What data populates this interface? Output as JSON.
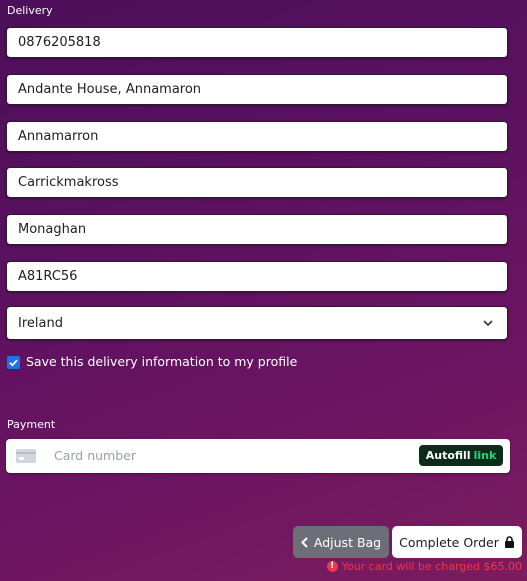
{
  "delivery": {
    "heading": "Delivery",
    "phone": "0876205818",
    "address_line1": "Andante House, Annamaron",
    "address_line2": "Annamarron",
    "town": "Carrickmakross",
    "county": "Monaghan",
    "postcode": "A81RC56",
    "country": "Ireland",
    "save_label": "Save this delivery information to my profile",
    "save_checked": true
  },
  "payment": {
    "heading": "Payment",
    "card_placeholder": "Card number",
    "autofill_label": "Autofill",
    "autofill_link": "link",
    "card_icon": "credit-card-icon"
  },
  "actions": {
    "adjust_label": "Adjust Bag",
    "adjust_icon": "chevron-left-icon",
    "complete_label": "Complete Order",
    "complete_icon": "lock-icon"
  },
  "notice": {
    "charge_text": "Your card will be charged $65.00",
    "icon": "alert-icon"
  },
  "colors": {
    "background": "#5a1160",
    "checkbox": "#1a73e8",
    "adjust_button": "#6e6e78",
    "autofill_bg": "#0d2b1b",
    "autofill_link": "#1cd87b",
    "charge_text": "#f0364d"
  }
}
